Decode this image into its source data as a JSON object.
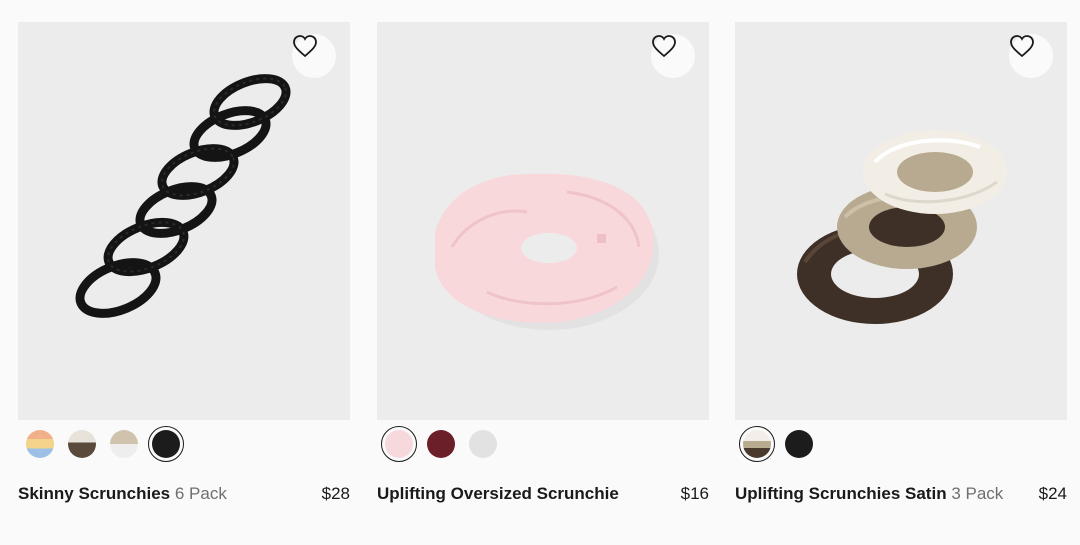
{
  "products": [
    {
      "name": "Skinny Scrunchies",
      "variant": "6 Pack",
      "price": "$28",
      "image_icon": "black-skinny-scrunchies-photo",
      "swatches": [
        {
          "name": "multi-stripe",
          "colors": [
            "#f1b08a",
            "#f4d38a",
            "#9cc0e6"
          ],
          "selected": false
        },
        {
          "name": "brown-taupe",
          "colors": [
            "#e7e2da",
            "#5a4a3c"
          ],
          "selected": false
        },
        {
          "name": "sand-white",
          "colors": [
            "#cfc3ad",
            "#eeeeee"
          ],
          "selected": false
        },
        {
          "name": "black",
          "colors": [
            "#1c1c1c"
          ],
          "selected": true
        }
      ]
    },
    {
      "name": "Uplifting Oversized Scrunchie",
      "variant": "",
      "price": "$16",
      "image_icon": "pink-oversized-scrunchie-photo",
      "swatches": [
        {
          "name": "pink",
          "colors": [
            "#f7d9dd"
          ],
          "selected": true
        },
        {
          "name": "burgundy",
          "colors": [
            "#6b1f29"
          ],
          "selected": false
        },
        {
          "name": "light-grey",
          "colors": [
            "#e2e2e2"
          ],
          "selected": false
        }
      ]
    },
    {
      "name": "Uplifting Scrunchies Satin",
      "variant": "3 Pack",
      "price": "$24",
      "image_icon": "satin-scrunchies-photo",
      "swatches": [
        {
          "name": "neutral-mix",
          "colors": [
            "#f3efe8",
            "#b9ab90",
            "#4a3a2e"
          ],
          "selected": true
        },
        {
          "name": "black",
          "colors": [
            "#1c1c1c"
          ],
          "selected": false
        }
      ]
    }
  ]
}
